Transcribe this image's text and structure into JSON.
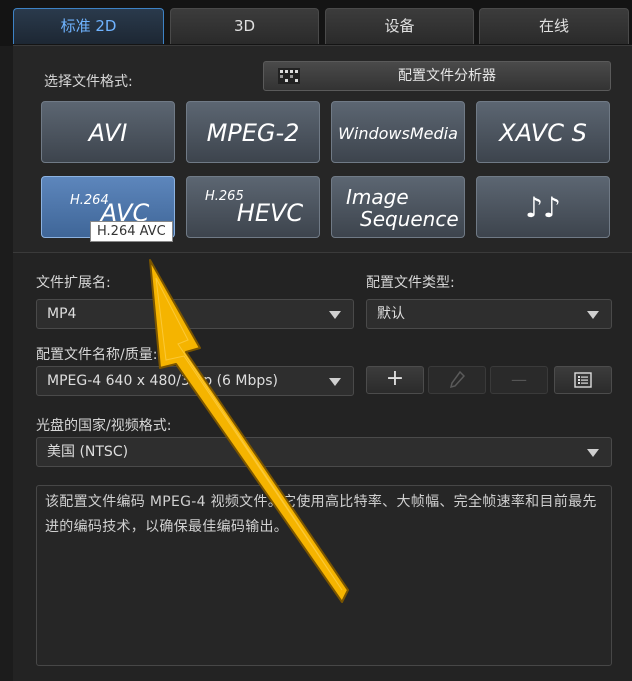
{
  "tabs": [
    {
      "label": "标准 2D",
      "active": true
    },
    {
      "label": "3D",
      "active": false
    },
    {
      "label": "设备",
      "active": false
    },
    {
      "label": "在线",
      "active": false
    }
  ],
  "format_section": {
    "label": "选择文件格式:",
    "analyzer_button": "配置文件分析器",
    "formats": [
      {
        "id": "avi",
        "text": "AVI"
      },
      {
        "id": "mpeg2",
        "text": "MPEG-2"
      },
      {
        "id": "windowsmedia",
        "text": "WindowsMedia"
      },
      {
        "id": "xavc-s",
        "text": "XAVC S"
      },
      {
        "id": "h264-avc",
        "prefix": "H.264",
        "text": "AVC",
        "selected": true
      },
      {
        "id": "h265-hevc",
        "prefix": "H.265",
        "text": "HEVC"
      },
      {
        "id": "image-sequence",
        "line1": "Image",
        "line2": "Sequence"
      },
      {
        "id": "audio",
        "text": "♪♪"
      }
    ],
    "tooltip": "H.264 AVC"
  },
  "settings": {
    "extension_label": "文件扩展名:",
    "extension_value": "MP4",
    "profile_type_label": "配置文件类型:",
    "profile_type_value": "默认",
    "profile_name_label": "配置文件名称/质量:",
    "profile_name_value": "MPEG-4 640 x 480/30 p (6 Mbps)",
    "add_label": "+",
    "remove_label": "—",
    "region_label": "光盘的国家/视频格式:",
    "region_value": "美国 (NTSC)"
  },
  "description": "该配置文件编码 MPEG-4 视频文件。它使用高比特率、大帧幅、完全帧速率和目前最先进的编码技术，以确保最佳编码输出。",
  "colors": {
    "accent_blue": "#3d82c5",
    "selected_format": "#4f78ad",
    "annotation_arrow": "#f5b400"
  }
}
